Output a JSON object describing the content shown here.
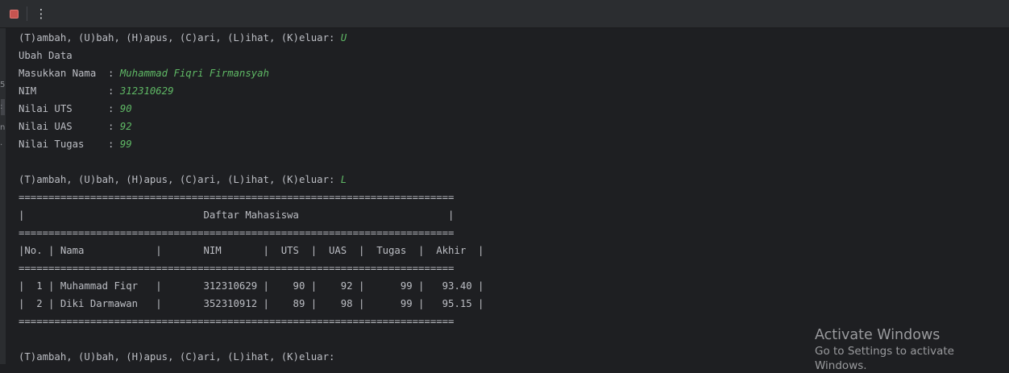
{
  "toolbar": {
    "stop_icon": "stop-square-icon",
    "more_icon": "vertical-ellipsis-icon",
    "more_glyph": "⋮",
    "accent_stop": "#c75450"
  },
  "gutter": {
    "marks": [
      "5",
      ":",
      "n",
      "."
    ]
  },
  "console": {
    "menu_prompt": "(T)ambah, (U)bah, (H)apus, (C)ari, (L)ihat, (K)eluar: ",
    "lines": [
      {
        "prefix": "(T)ambah, (U)bah, (H)apus, (C)ari, (L)ihat, (K)eluar: ",
        "input": "U"
      },
      {
        "prefix": "Ubah Data",
        "input": ""
      },
      {
        "prefix": "Masukkan Nama  : ",
        "input": "Muhammad Fiqri Firmansyah"
      },
      {
        "prefix": "NIM            : ",
        "input": "312310629"
      },
      {
        "prefix": "Nilai UTS      : ",
        "input": "90"
      },
      {
        "prefix": "Nilai UAS      : ",
        "input": "92"
      },
      {
        "prefix": "Nilai Tugas    : ",
        "input": "99"
      },
      {
        "prefix": "",
        "input": ""
      },
      {
        "prefix": "(T)ambah, (U)bah, (H)apus, (C)ari, (L)ihat, (K)eluar: ",
        "input": "L"
      },
      {
        "prefix": "=========================================================================",
        "input": ""
      },
      {
        "prefix": "|                              Daftar Mahasiswa                         |",
        "input": ""
      },
      {
        "prefix": "=========================================================================",
        "input": ""
      },
      {
        "prefix": "|No. | Nama            |       NIM       |  UTS  |  UAS  |  Tugas  |  Akhir  |",
        "input": ""
      },
      {
        "prefix": "=========================================================================",
        "input": ""
      },
      {
        "prefix": "|  1 | Muhammad Fiqr   |       312310629 |    90 |    92 |      99 |   93.40 |",
        "input": ""
      },
      {
        "prefix": "|  2 | Diki Darmawan   |       352310912 |    89 |    98 |      99 |   95.15 |",
        "input": ""
      },
      {
        "prefix": "=========================================================================",
        "input": ""
      },
      {
        "prefix": "",
        "input": ""
      },
      {
        "prefix": "(T)ambah, (U)bah, (H)apus, (C)ari, (L)ihat, (K)eluar: ",
        "input": ""
      }
    ],
    "colors": {
      "output": "#bcbec4",
      "input": "#5fb865",
      "background": "#1e1f22"
    }
  },
  "watermark": {
    "title": "Activate Windows",
    "subtitle": "Go to Settings to activate Windows."
  }
}
